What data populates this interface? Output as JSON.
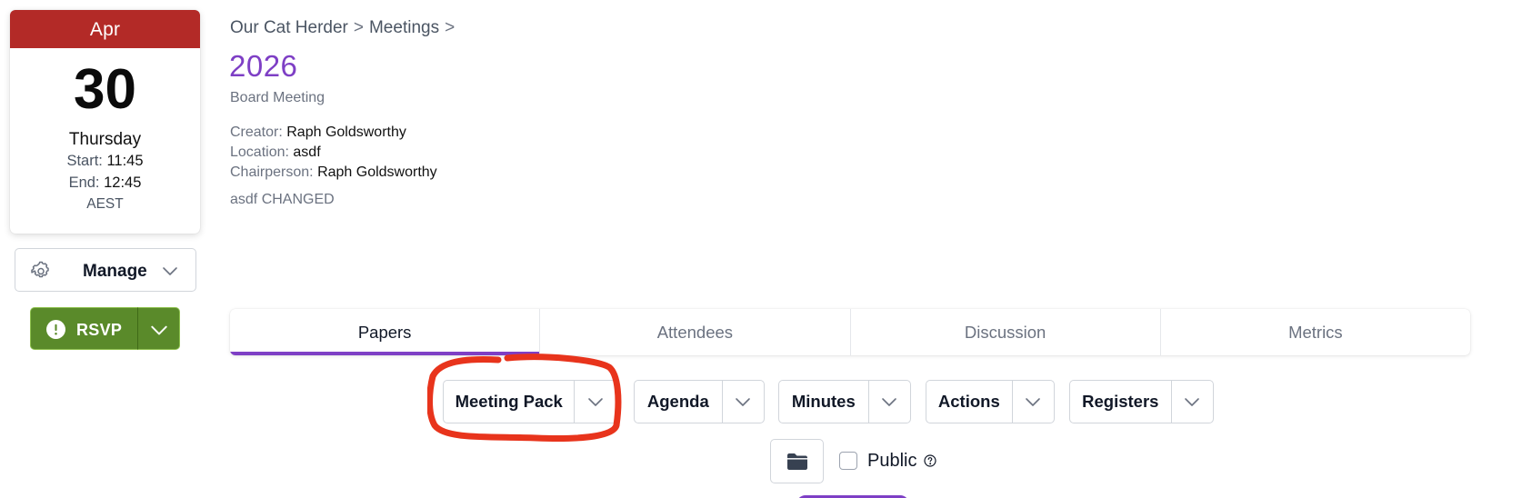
{
  "calendar": {
    "month": "Apr",
    "day": "30",
    "weekday": "Thursday",
    "start_label": "Start:",
    "start_time": "11:45",
    "end_label": "End:",
    "end_time": "12:45",
    "timezone": "AEST"
  },
  "actions": {
    "manage_label": "Manage",
    "rsvp_label": "RSVP"
  },
  "breadcrumb": [
    "Our Cat Herder",
    "Meetings"
  ],
  "breadcrumb_separator": ">",
  "header": {
    "title": "2026",
    "subtitle": "Board Meeting",
    "creator_label": "Creator:",
    "creator": "Raph Goldsworthy",
    "location_label": "Location:",
    "location": "asdf",
    "chair_label": "Chairperson:",
    "chair": "Raph Goldsworthy",
    "description": "asdf CHANGED"
  },
  "tabs": [
    {
      "label": "Papers",
      "active": true
    },
    {
      "label": "Attendees",
      "active": false
    },
    {
      "label": "Discussion",
      "active": false
    },
    {
      "label": "Metrics",
      "active": false
    }
  ],
  "papers": {
    "buttons": [
      "Meeting Pack",
      "Agenda",
      "Minutes",
      "Actions",
      "Registers"
    ],
    "public_label": "Public",
    "public_checked": false
  },
  "colors": {
    "accent_purple": "#7e3fc5",
    "calendar_red": "#b32a27",
    "rsvp_green": "#5a8a2a",
    "annotation_red": "#e8341c"
  }
}
